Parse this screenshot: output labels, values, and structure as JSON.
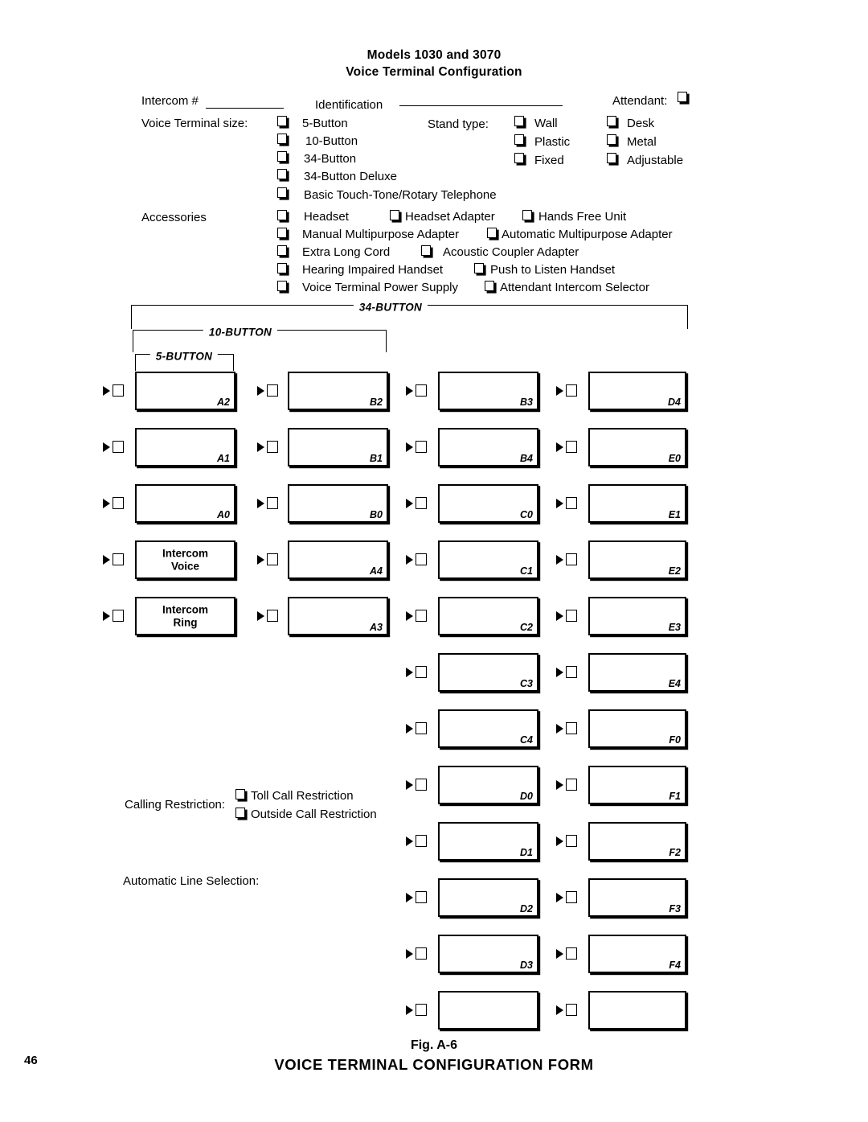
{
  "document": {
    "title_line1": "Models 1030 and 3070",
    "title_line2": "Voice Terminal Configuration",
    "page_number": "46",
    "figure_number": "Fig. A-6",
    "figure_caption": "VOICE TERMINAL CONFIGURATION FORM"
  },
  "header_fields": {
    "intercom_label": "Intercom #",
    "identification_label": "Identification",
    "attendant_label": "Attendant:"
  },
  "terminal_size": {
    "label": "Voice Terminal size:",
    "options": [
      "5-Button",
      "10-Button",
      "34-Button",
      "34-Button  Deluxe",
      "Basic Touch-Tone/Rotary Telephone"
    ]
  },
  "stand_type": {
    "label": "Stand type:",
    "column1": [
      "Wall",
      "Plastic",
      "Fixed"
    ],
    "column2": [
      "Desk",
      "Metal",
      "Adjustable"
    ]
  },
  "accessories": {
    "label": "Accessories",
    "rows": [
      [
        "Headset",
        "Headset Adapter",
        "Hands Free Unit"
      ],
      [
        "Manual Multipurpose Adapter",
        "Automatic Multipurpose Adapter"
      ],
      [
        "Extra Long Cord",
        "Acoustic  Coupler  Adapter"
      ],
      [
        "Hearing Impaired Handset",
        "Push to Listen Handset"
      ],
      [
        "Voice  Terminal  Power  Supply",
        "Attendant Intercom Selector"
      ]
    ]
  },
  "brackets": [
    {
      "label": "34-BUTTON"
    },
    {
      "label": "10-BUTTON"
    },
    {
      "label": "5-BUTTON"
    }
  ],
  "button_grid": {
    "columns": [
      {
        "name": "column-1",
        "cells": [
          {
            "code": "A2",
            "text": ""
          },
          {
            "code": "A1",
            "text": ""
          },
          {
            "code": "A0",
            "text": ""
          },
          {
            "code": "",
            "text": "Intercom\nVoice"
          },
          {
            "code": "",
            "text": "Intercom\nRing"
          }
        ]
      },
      {
        "name": "column-2",
        "cells": [
          {
            "code": "B2",
            "text": ""
          },
          {
            "code": "B1",
            "text": ""
          },
          {
            "code": "B0",
            "text": ""
          },
          {
            "code": "A4",
            "text": ""
          },
          {
            "code": "A3",
            "text": ""
          }
        ]
      },
      {
        "name": "column-3",
        "cells": [
          {
            "code": "B3",
            "text": ""
          },
          {
            "code": "B4",
            "text": ""
          },
          {
            "code": "C0",
            "text": ""
          },
          {
            "code": "C1",
            "text": ""
          },
          {
            "code": "C2",
            "text": ""
          },
          {
            "code": "C3",
            "text": ""
          },
          {
            "code": "C4",
            "text": ""
          },
          {
            "code": "D0",
            "text": ""
          },
          {
            "code": "D1",
            "text": ""
          },
          {
            "code": "D2",
            "text": ""
          },
          {
            "code": "D3",
            "text": ""
          },
          {
            "code": "",
            "text": ""
          }
        ]
      },
      {
        "name": "column-4",
        "cells": [
          {
            "code": "D4",
            "text": ""
          },
          {
            "code": "E0",
            "text": ""
          },
          {
            "code": "E1",
            "text": ""
          },
          {
            "code": "E2",
            "text": ""
          },
          {
            "code": "E3",
            "text": ""
          },
          {
            "code": "E4",
            "text": ""
          },
          {
            "code": "F0",
            "text": ""
          },
          {
            "code": "F1",
            "text": ""
          },
          {
            "code": "F2",
            "text": ""
          },
          {
            "code": "F3",
            "text": ""
          },
          {
            "code": "F4",
            "text": ""
          },
          {
            "code": "",
            "text": ""
          }
        ]
      }
    ]
  },
  "calling_restriction": {
    "label": "Calling  Restriction:",
    "options": [
      "Toll Call Restriction",
      "Outside Call Restriction"
    ]
  },
  "automatic_line_selection": {
    "label": "Automatic Line Selection:"
  }
}
